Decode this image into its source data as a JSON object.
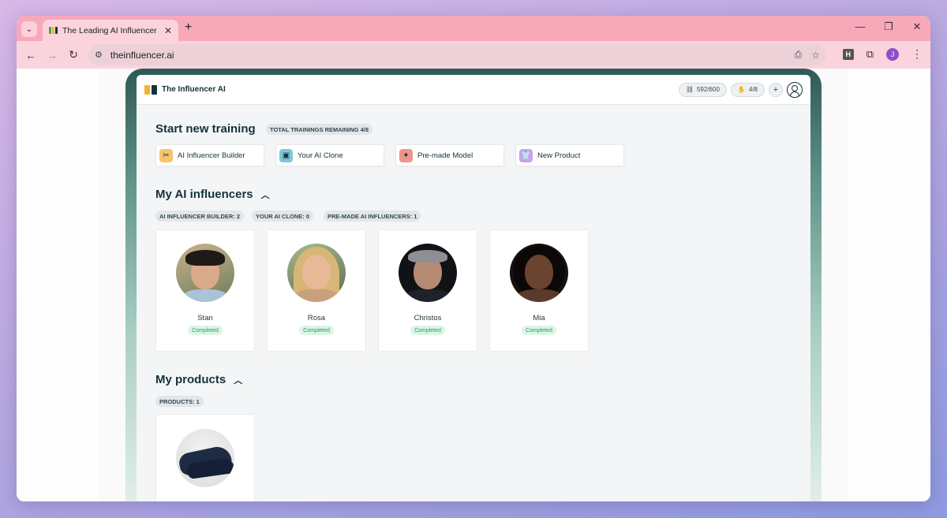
{
  "browser": {
    "tab_title": "The Leading AI Influencer Gene",
    "url": "theinfluencer.ai",
    "profile_initial": "J",
    "extension_label": "H"
  },
  "app": {
    "brand": "The Influencer AI",
    "credits": "592/600",
    "trainings_pill": "4/8"
  },
  "training": {
    "title": "Start new training",
    "remaining_badge": "TOTAL TRAININGS REMAINING 4/8",
    "options": [
      {
        "label": "AI Influencer Builder",
        "icon": "tools-icon",
        "color": "#f7c36b"
      },
      {
        "label": "Your AI Clone",
        "icon": "image-user-icon",
        "color": "#7fc7d9"
      },
      {
        "label": "Pre-made Model",
        "icon": "cursor-sparkle-icon",
        "color": "#f1948a"
      },
      {
        "label": "New Product",
        "icon": "shirt-icon",
        "color": "#c9a3e6"
      }
    ]
  },
  "influencers": {
    "title": "My AI influencers",
    "badges": [
      "AI INFLUENCER BUILDER: 2",
      "YOUR AI CLONE: 0",
      "PRE-MADE AI INFLUENCERS: 1"
    ],
    "items": [
      {
        "name": "Stan",
        "status": "Completed"
      },
      {
        "name": "Rosa",
        "status": "Completed"
      },
      {
        "name": "Christos",
        "status": "Completed"
      },
      {
        "name": "Mia",
        "status": "Completed"
      }
    ]
  },
  "products": {
    "title": "My products",
    "badge": "PRODUCTS: 1"
  }
}
